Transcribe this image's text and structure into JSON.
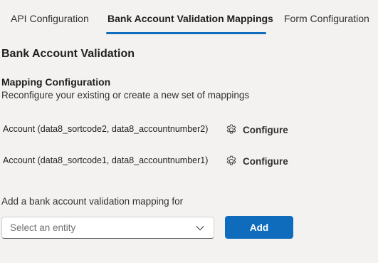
{
  "tabs": [
    {
      "label": "API Configuration",
      "active": false
    },
    {
      "label": "Bank Account Validation Mappings",
      "active": true
    },
    {
      "label": "Form Configuration",
      "active": false
    }
  ],
  "section": {
    "title": "Bank Account Validation"
  },
  "mapping_config": {
    "title": "Mapping Configuration",
    "description": "Reconfigure your existing or create a new set of mappings"
  },
  "mappings": [
    {
      "label": "Account (data8_sortcode2, data8_accountnumber2)",
      "action": "Configure",
      "icon": "gear-icon"
    },
    {
      "label": "Account (data8_sortcode1, data8_accountnumber1)",
      "action": "Configure",
      "icon": "gear-icon"
    }
  ],
  "add_mapping": {
    "label": "Add a bank account validation mapping for",
    "select_placeholder": "Select an entity",
    "button_label": "Add",
    "icon": "chevron-down-icon"
  },
  "colors": {
    "accent": "#0f6cbd",
    "background": "#f3f2f1"
  }
}
